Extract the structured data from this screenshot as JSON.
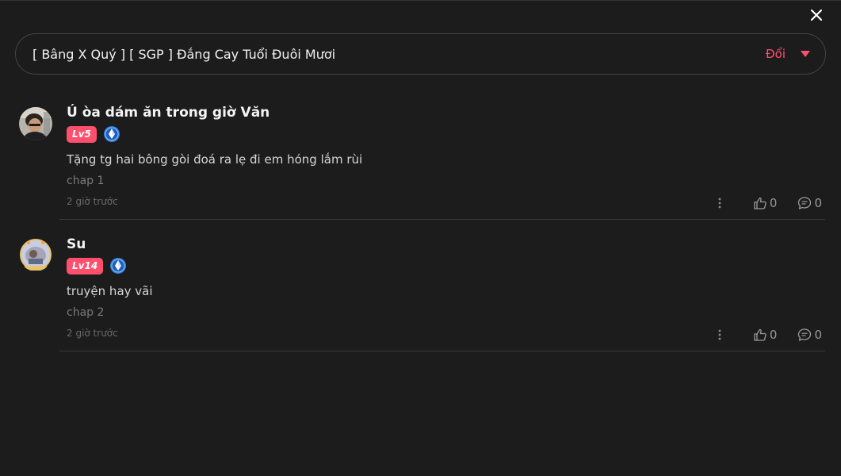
{
  "header": {
    "close_icon": "close-icon"
  },
  "selector": {
    "title": "[ Bâng X Quý ] [ SGP ] Đắng Cay Tuổi Đuôi Mươi",
    "change_label": "Đổi",
    "accent_color": "#ff4f6e"
  },
  "comments": [
    {
      "user": "Ú òa dám ăn trong giờ Văn",
      "level": "Lv5",
      "text": "Tặng tg hai bông gòi đoá ra lẹ đi em hóng lắm rùi",
      "chapter": "chap 1",
      "time": "2 giờ trước",
      "likes": "0",
      "replies": "0"
    },
    {
      "user": "Su",
      "level": "Lv14",
      "text": "truyện hay vãi",
      "chapter": "chap 2",
      "time": "2 giờ trước",
      "likes": "0",
      "replies": "0"
    }
  ]
}
